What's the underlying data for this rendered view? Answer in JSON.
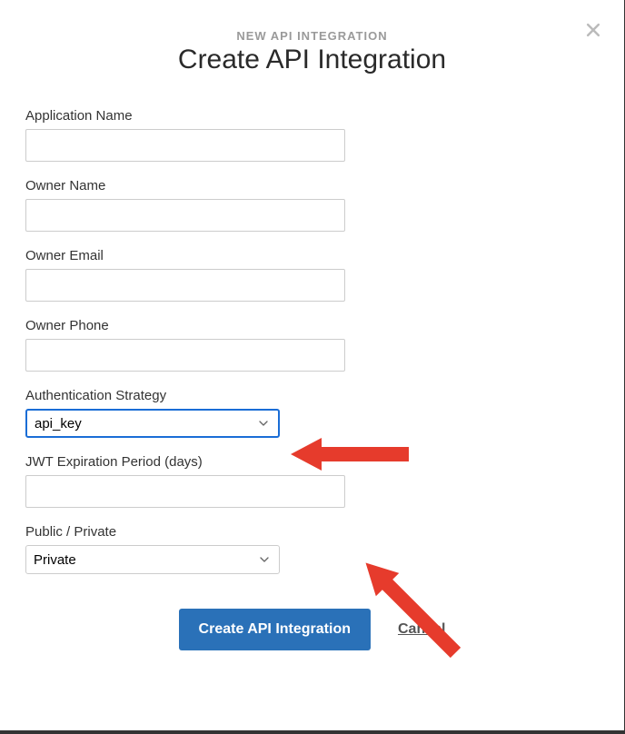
{
  "header": {
    "eyebrow": "NEW API INTEGRATION",
    "title": "Create API Integration"
  },
  "form": {
    "application_name": {
      "label": "Application Name",
      "value": ""
    },
    "owner_name": {
      "label": "Owner Name",
      "value": ""
    },
    "owner_email": {
      "label": "Owner Email",
      "value": ""
    },
    "owner_phone": {
      "label": "Owner Phone",
      "value": ""
    },
    "auth_strategy": {
      "label": "Authentication Strategy",
      "value": "api_key"
    },
    "jwt_expiration": {
      "label": "JWT Expiration Period (days)",
      "value": ""
    },
    "public_private": {
      "label": "Public / Private",
      "value": "Private"
    }
  },
  "actions": {
    "submit_label": "Create API Integration",
    "cancel_label": "Cancel"
  }
}
